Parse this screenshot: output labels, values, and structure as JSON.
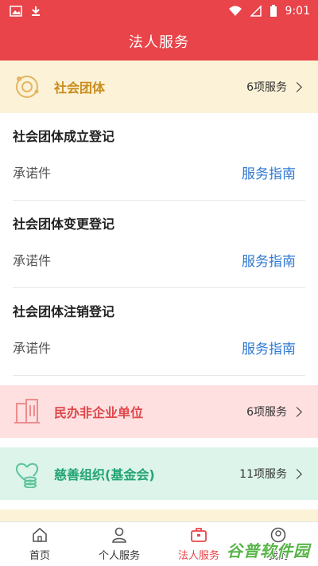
{
  "status_bar": {
    "time": "9:01"
  },
  "app_bar": {
    "title": "法人服务"
  },
  "categories": {
    "social": {
      "title": "社会团体",
      "count": "6项服务"
    },
    "minban": {
      "title": "民办非企业单位",
      "count": "6项服务"
    },
    "charity": {
      "title": "慈善组织(基金会)",
      "count": "11项服务"
    }
  },
  "services": [
    {
      "name": "社会团体成立登记",
      "tag": "承诺件",
      "guide": "服务指南"
    },
    {
      "name": "社会团体变更登记",
      "tag": "承诺件",
      "guide": "服务指南"
    },
    {
      "name": "社会团体注销登记",
      "tag": "承诺件",
      "guide": "服务指南"
    }
  ],
  "tabs": [
    {
      "label": "首页",
      "icon": "home-icon"
    },
    {
      "label": "个人服务",
      "icon": "person-icon"
    },
    {
      "label": "法人服务",
      "icon": "briefcase-icon",
      "active": true
    },
    {
      "label": "我的",
      "icon": "user-icon"
    }
  ],
  "watermark": "谷普软件园",
  "colors": {
    "primary": "#e8444a",
    "link": "#2f78d1",
    "gold": "#c98d1c",
    "green": "#22a473"
  }
}
